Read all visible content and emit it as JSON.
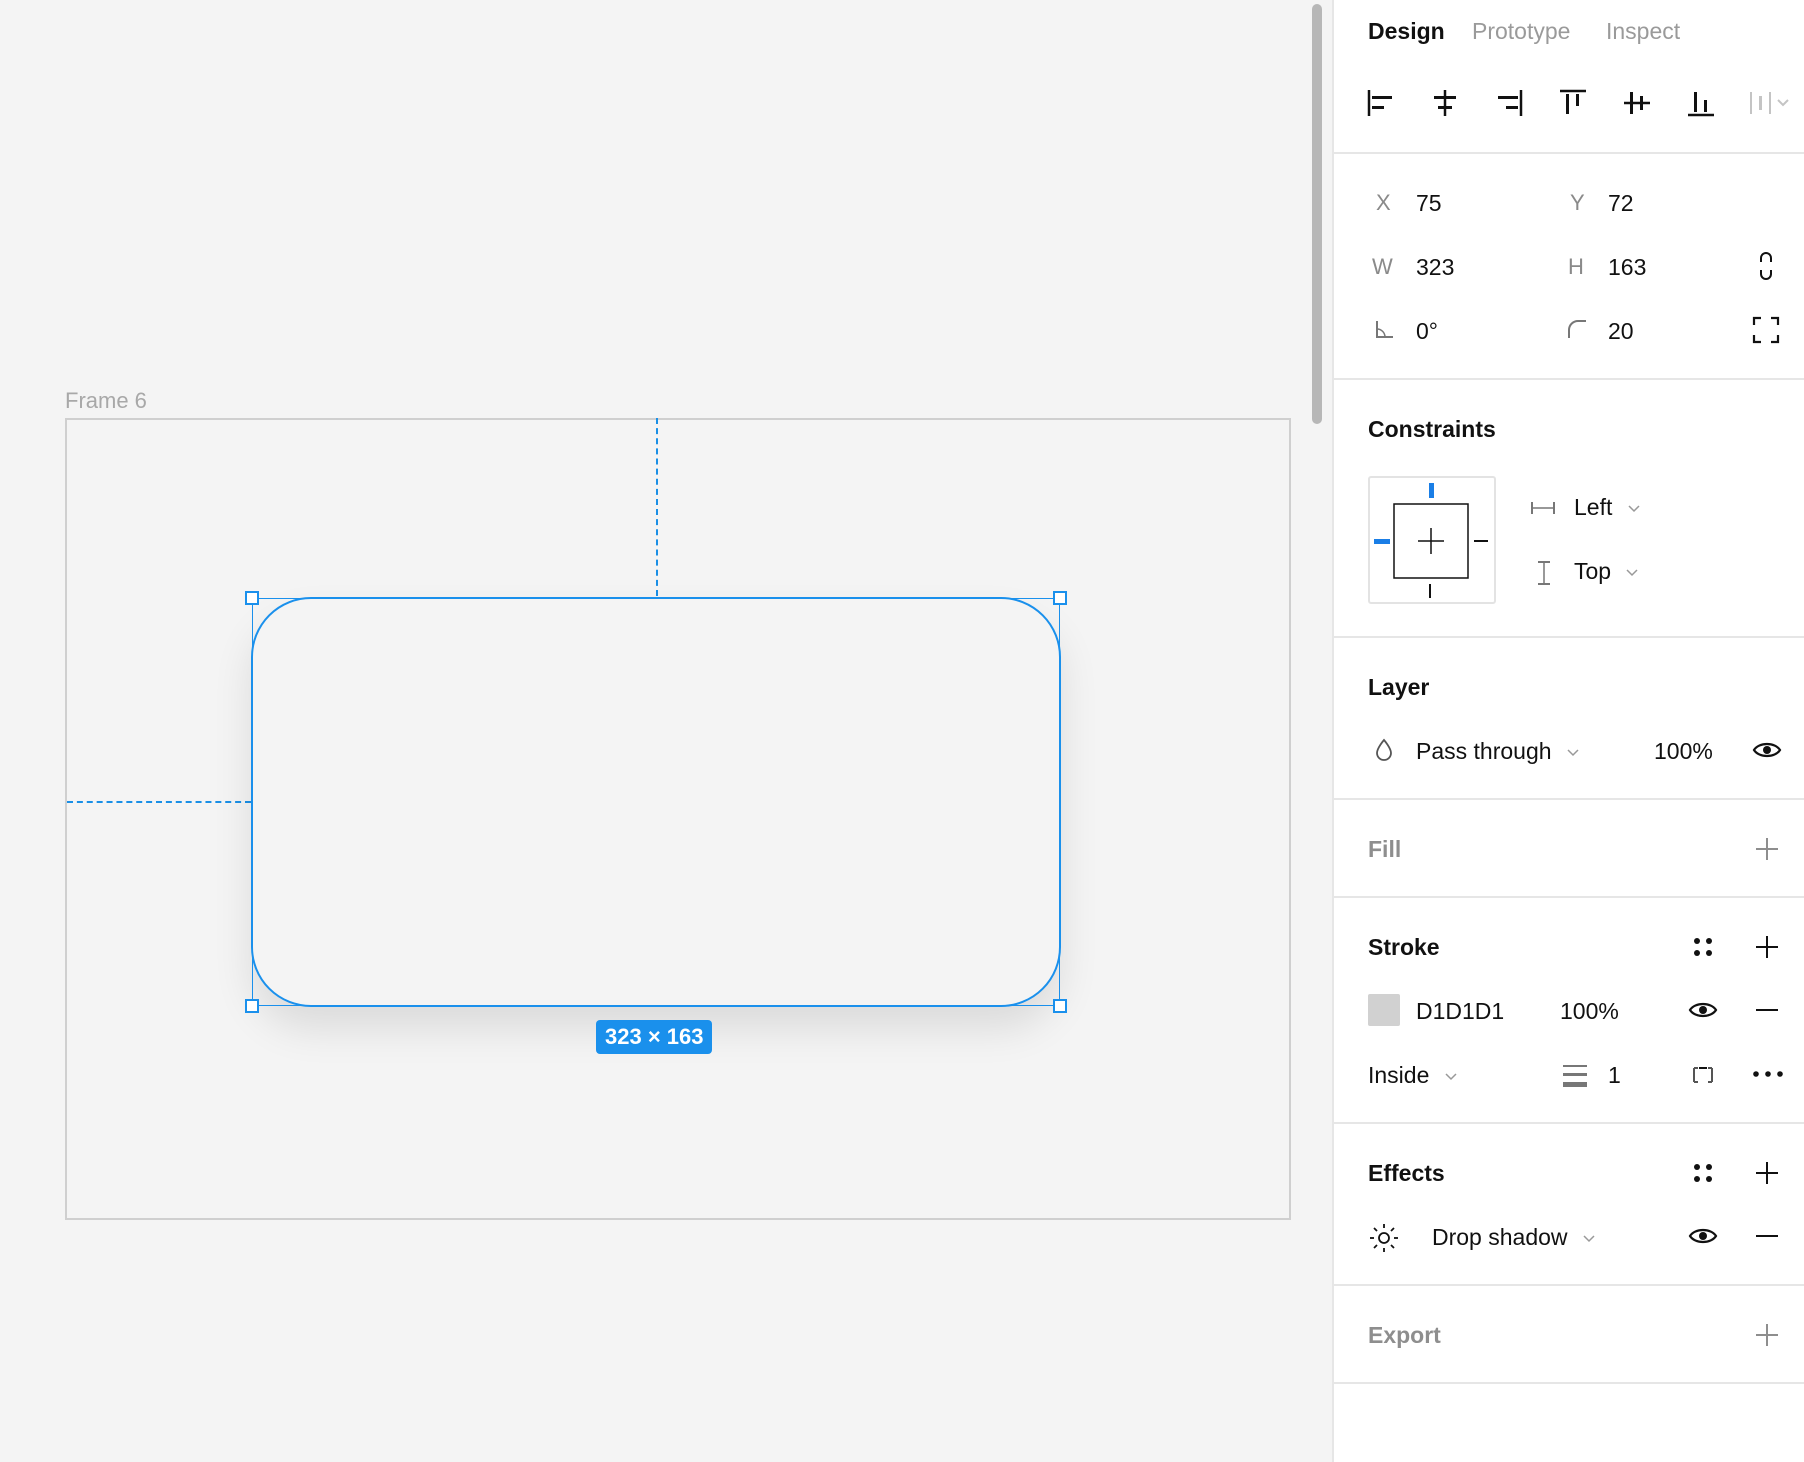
{
  "canvas": {
    "frame_label": "Frame 6",
    "size_badge": "323 × 163",
    "selection_color": "#1a90ec"
  },
  "panel": {
    "tabs": [
      {
        "label": "Design",
        "active": true
      },
      {
        "label": "Prototype",
        "active": false
      },
      {
        "label": "Inspect",
        "active": false
      }
    ],
    "align_icons": [
      "align-left-icon",
      "align-horizontal-center-icon",
      "align-right-icon",
      "align-top-icon",
      "align-vertical-center-icon",
      "align-bottom-icon",
      "distribute-icon"
    ],
    "geometry": {
      "x_label": "X",
      "x": "75",
      "y_label": "Y",
      "y": "72",
      "w_label": "W",
      "w": "323",
      "h_label": "H",
      "h": "163",
      "rotation": "0°",
      "radius": "20"
    },
    "constraints": {
      "title": "Constraints",
      "horizontal": "Left",
      "vertical": "Top"
    },
    "layer": {
      "title": "Layer",
      "blend_mode": "Pass through",
      "opacity": "100%"
    },
    "fill": {
      "title": "Fill"
    },
    "stroke": {
      "title": "Stroke",
      "color_hex": "D1D1D1",
      "swatch_color": "#d1d1d1",
      "opacity": "100%",
      "position": "Inside",
      "weight": "1"
    },
    "effects": {
      "title": "Effects",
      "effect": "Drop shadow"
    },
    "export": {
      "title": "Export"
    }
  }
}
